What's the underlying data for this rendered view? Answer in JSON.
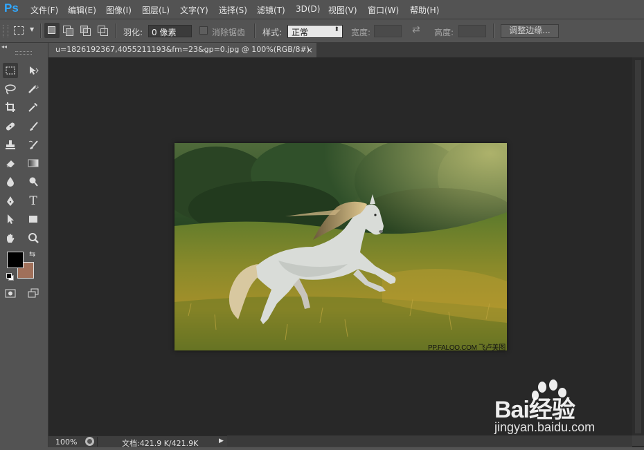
{
  "app": {
    "logo": "Ps"
  },
  "menus": [
    "文件(F)",
    "编辑(E)",
    "图像(I)",
    "图层(L)",
    "文字(Y)",
    "选择(S)",
    "滤镜(T)",
    "3D(D)",
    "视图(V)",
    "窗口(W)",
    "帮助(H)"
  ],
  "options": {
    "feather_label": "羽化:",
    "feather_value": "0 像素",
    "antialias_label": "消除锯齿",
    "style_label": "样式:",
    "style_value": "正常",
    "width_label": "宽度:",
    "height_label": "高度:",
    "refine_label": "调整边缘..."
  },
  "document": {
    "tab_title": "u=1826192367,4055211193&fm=23&gp=0.jpg @ 100%(RGB/8#)",
    "close_glyph": "×",
    "photo_watermark": "PP.FALOO.COM 飞卢美图"
  },
  "status": {
    "zoom": "100%",
    "doc_info": "文档:421.9 K/421.9K"
  },
  "colors": {
    "foreground": "#000000",
    "background": "#a0705a",
    "accent": "#31a8ff"
  },
  "watermark": {
    "logo": "Bai经验",
    "url": "jingyan.baidu.com"
  }
}
